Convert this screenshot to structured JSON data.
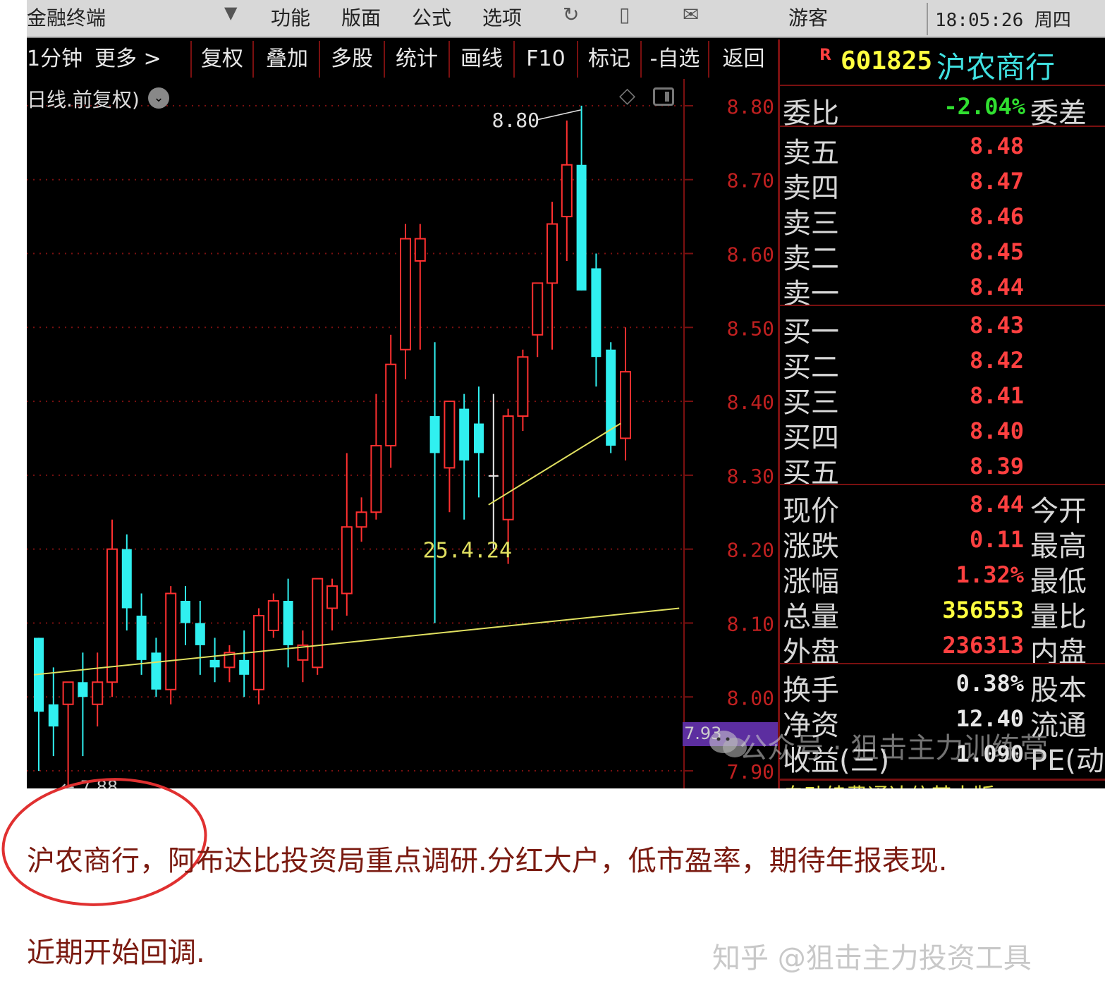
{
  "menubar": {
    "app_title": "金融终端",
    "items": [
      "功能",
      "版面",
      "公式",
      "选项"
    ],
    "user": "游客",
    "clock": "18:05:26 周四"
  },
  "toolbar": {
    "period": "1分钟",
    "more": "更多 >",
    "buttons": [
      "复权",
      "叠加",
      "多股",
      "统计",
      "画线",
      "F10",
      "标记",
      "-自选",
      "返回"
    ]
  },
  "chart": {
    "mode_label": "日线.前复权)",
    "price_axis": [
      "8.80",
      "8.70",
      "8.60",
      "8.50",
      "8.40",
      "8.30",
      "8.20",
      "8.10",
      "8.00",
      "7.90"
    ],
    "high_annotation": "8.80",
    "date_annotation": "25.4.24",
    "low_tag": "7.93",
    "low_annotation": "7.88",
    "up_color": "#ff3030",
    "down_color": "#30f0f0",
    "trendline_color": "#e0e060"
  },
  "chart_data": {
    "type": "candlestick",
    "ylim": [
      7.88,
      8.84
    ],
    "candles": [
      {
        "o": 8.08,
        "h": 8.01,
        "l": 7.9,
        "c": 7.98,
        "dir": "down"
      },
      {
        "o": 7.99,
        "h": 8.04,
        "l": 7.92,
        "c": 7.96,
        "dir": "down"
      },
      {
        "o": 7.99,
        "h": 8.02,
        "l": 7.88,
        "c": 8.02,
        "dir": "up"
      },
      {
        "o": 8.02,
        "h": 8.06,
        "l": 7.92,
        "c": 8.0,
        "dir": "down"
      },
      {
        "o": 7.99,
        "h": 8.06,
        "l": 7.96,
        "c": 8.02,
        "dir": "up"
      },
      {
        "o": 8.02,
        "h": 8.24,
        "l": 8.0,
        "c": 8.2,
        "dir": "up"
      },
      {
        "o": 8.2,
        "h": 8.22,
        "l": 8.09,
        "c": 8.12,
        "dir": "down"
      },
      {
        "o": 8.11,
        "h": 8.14,
        "l": 8.03,
        "c": 8.05,
        "dir": "down"
      },
      {
        "o": 8.06,
        "h": 8.08,
        "l": 8.0,
        "c": 8.01,
        "dir": "down"
      },
      {
        "o": 8.01,
        "h": 8.15,
        "l": 7.99,
        "c": 8.14,
        "dir": "up"
      },
      {
        "o": 8.13,
        "h": 8.15,
        "l": 8.07,
        "c": 8.1,
        "dir": "down"
      },
      {
        "o": 8.1,
        "h": 8.13,
        "l": 8.03,
        "c": 8.07,
        "dir": "down"
      },
      {
        "o": 8.05,
        "h": 8.08,
        "l": 8.02,
        "c": 8.04,
        "dir": "down"
      },
      {
        "o": 8.04,
        "h": 8.07,
        "l": 8.02,
        "c": 8.06,
        "dir": "up"
      },
      {
        "o": 8.05,
        "h": 8.09,
        "l": 8.0,
        "c": 8.03,
        "dir": "down"
      },
      {
        "o": 8.01,
        "h": 8.12,
        "l": 7.99,
        "c": 8.11,
        "dir": "up"
      },
      {
        "o": 8.09,
        "h": 8.14,
        "l": 8.08,
        "c": 8.13,
        "dir": "up"
      },
      {
        "o": 8.13,
        "h": 8.16,
        "l": 8.04,
        "c": 8.07,
        "dir": "down"
      },
      {
        "o": 8.05,
        "h": 8.09,
        "l": 8.02,
        "c": 8.07,
        "dir": "up"
      },
      {
        "o": 8.04,
        "h": 8.16,
        "l": 8.03,
        "c": 8.16,
        "dir": "up"
      },
      {
        "o": 8.12,
        "h": 8.16,
        "l": 8.09,
        "c": 8.15,
        "dir": "up"
      },
      {
        "o": 8.14,
        "h": 8.33,
        "l": 8.11,
        "c": 8.23,
        "dir": "up"
      },
      {
        "o": 8.23,
        "h": 8.27,
        "l": 8.21,
        "c": 8.25,
        "dir": "up"
      },
      {
        "o": 8.25,
        "h": 8.41,
        "l": 8.24,
        "c": 8.34,
        "dir": "up"
      },
      {
        "o": 8.34,
        "h": 8.49,
        "l": 8.31,
        "c": 8.45,
        "dir": "up"
      },
      {
        "o": 8.47,
        "h": 8.64,
        "l": 8.43,
        "c": 8.62,
        "dir": "up"
      },
      {
        "o": 8.59,
        "h": 8.64,
        "l": 8.47,
        "c": 8.62,
        "dir": "up"
      },
      {
        "o": 8.38,
        "h": 8.48,
        "l": 8.1,
        "c": 8.33,
        "dir": "down"
      },
      {
        "o": 8.31,
        "h": 8.4,
        "l": 8.25,
        "c": 8.4,
        "dir": "up"
      },
      {
        "o": 8.39,
        "h": 8.41,
        "l": 8.24,
        "c": 8.32,
        "dir": "down"
      },
      {
        "o": 8.37,
        "h": 8.42,
        "l": 8.27,
        "c": 8.33,
        "dir": "down"
      },
      {
        "o": 8.3,
        "h": 8.41,
        "l": 8.2,
        "c": 8.3,
        "dir": "flat"
      },
      {
        "o": 8.24,
        "h": 8.39,
        "l": 8.18,
        "c": 8.38,
        "dir": "up"
      },
      {
        "o": 8.38,
        "h": 8.47,
        "l": 8.36,
        "c": 8.46,
        "dir": "up"
      },
      {
        "o": 8.49,
        "h": 8.56,
        "l": 8.46,
        "c": 8.56,
        "dir": "up"
      },
      {
        "o": 8.56,
        "h": 8.67,
        "l": 8.47,
        "c": 8.64,
        "dir": "up"
      },
      {
        "o": 8.65,
        "h": 8.78,
        "l": 8.59,
        "c": 8.72,
        "dir": "up"
      },
      {
        "o": 8.72,
        "h": 8.8,
        "l": 8.55,
        "c": 8.55,
        "dir": "down"
      },
      {
        "o": 8.58,
        "h": 8.6,
        "l": 8.42,
        "c": 8.46,
        "dir": "down"
      },
      {
        "o": 8.47,
        "h": 8.48,
        "l": 8.33,
        "c": 8.34,
        "dir": "down"
      },
      {
        "o": 8.35,
        "h": 8.5,
        "l": 8.32,
        "c": 8.44,
        "dir": "up"
      }
    ],
    "trendlines": [
      {
        "from": [
          0,
          8.03
        ],
        "to": [
          44,
          8.12
        ]
      },
      {
        "from": [
          31,
          8.26
        ],
        "to": [
          40,
          8.37
        ]
      }
    ]
  },
  "quote": {
    "r_mark": "R",
    "code": "601825",
    "name": "沪农商行",
    "weibi_label": "委比",
    "weibi_value": "-2.04%",
    "weicha_label": "委差",
    "asks": [
      {
        "label": "卖五",
        "price": "8.48"
      },
      {
        "label": "卖四",
        "price": "8.47"
      },
      {
        "label": "卖三",
        "price": "8.46"
      },
      {
        "label": "卖二",
        "price": "8.45"
      },
      {
        "label": "卖一",
        "price": "8.44"
      }
    ],
    "bids": [
      {
        "label": "买一",
        "price": "8.43"
      },
      {
        "label": "买二",
        "price": "8.42"
      },
      {
        "label": "买三",
        "price": "8.41"
      },
      {
        "label": "买四",
        "price": "8.40"
      },
      {
        "label": "买五",
        "price": "8.39"
      }
    ],
    "stats": [
      {
        "label": "现价",
        "value": "8.44",
        "right": "今开",
        "color": "#ff4040"
      },
      {
        "label": "涨跌",
        "value": "0.11",
        "right": "最高",
        "color": "#ff4040"
      },
      {
        "label": "涨幅",
        "value": "1.32%",
        "right": "最低",
        "color": "#ff4040"
      },
      {
        "label": "总量",
        "value": "356553",
        "right": "量比",
        "color": "#ffff40"
      },
      {
        "label": "外盘",
        "value": "236313",
        "right": "内盘",
        "color": "#ff4040"
      }
    ],
    "fundamentals": [
      {
        "label": "换手",
        "value": "0.38%",
        "right": "股本"
      },
      {
        "label": "净资",
        "value": "12.40",
        "right": "流通"
      },
      {
        "label": "收益(三)",
        "value": "1.090",
        "right": "PE(动)"
      }
    ],
    "scroll_text": "自动续费通达信基本版"
  },
  "watermark": "公众号 · 狙击主力训练营",
  "caption": {
    "line1": "沪农商行，阿布达比投资局重点调研.分红大户，低市盈率，期待年报表现.",
    "line2": "近期开始回调.",
    "zhihu": "知乎 @狙击主力投资工具"
  }
}
